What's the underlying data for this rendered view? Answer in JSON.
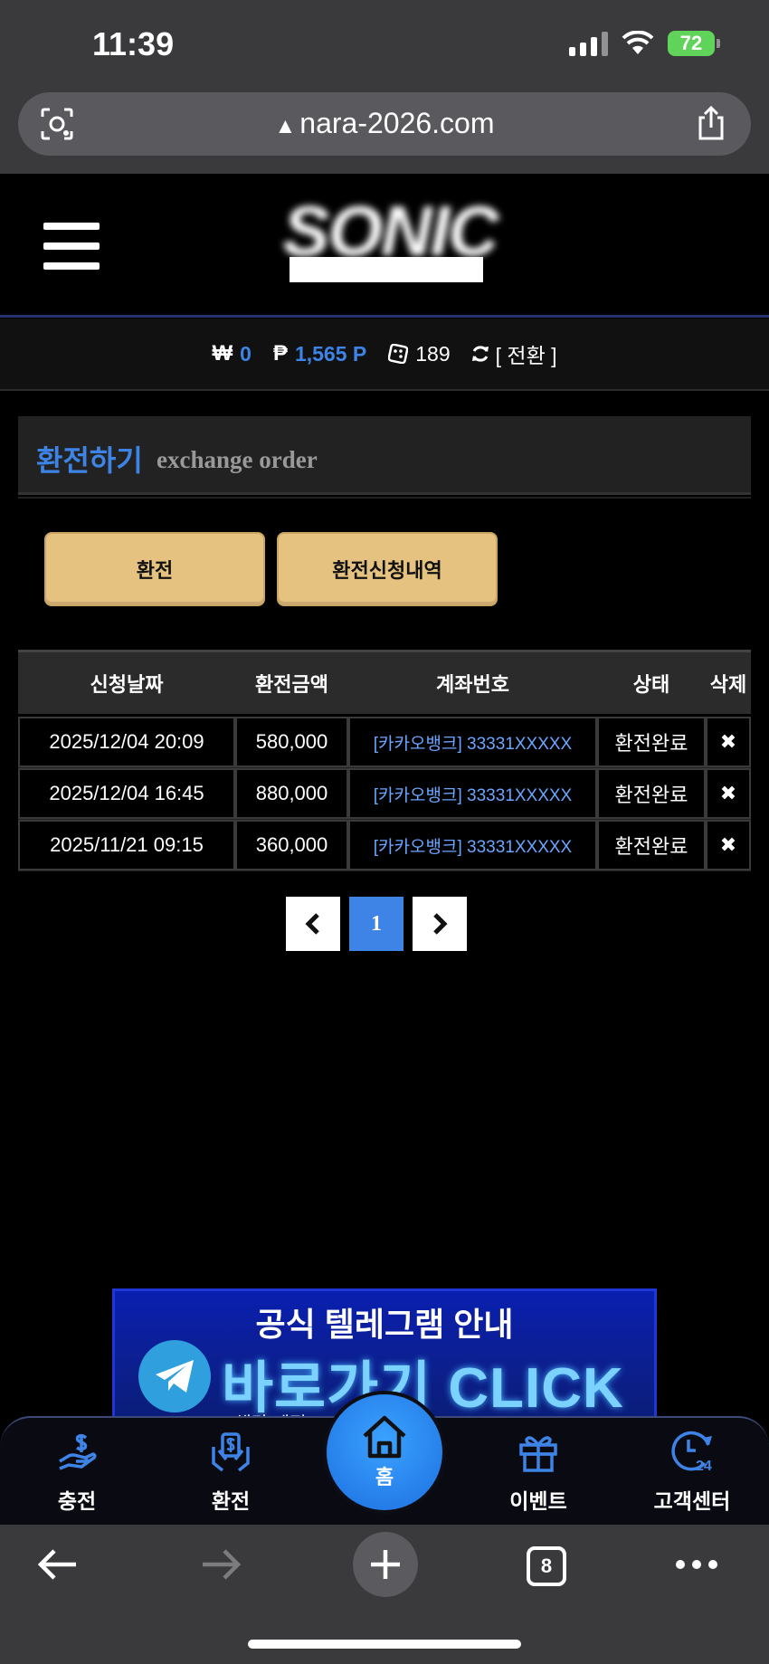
{
  "status_bar": {
    "time": "11:39",
    "battery": "72"
  },
  "browser": {
    "url": "nara-2026.com"
  },
  "header": {
    "logo_text": "SONIC"
  },
  "balance": {
    "cash_symbol": "₩",
    "cash": "0",
    "point_symbol": "₱",
    "points": "1,565 P",
    "chips": "189",
    "convert_label": "[ 전환 ]"
  },
  "page": {
    "title_ko": "환전하기",
    "title_en": "exchange order"
  },
  "actions": {
    "exchange_label": "환전",
    "history_label": "환전신청내역"
  },
  "table": {
    "headers": [
      "신청날짜",
      "환전금액",
      "계좌번호",
      "상태",
      "삭제"
    ],
    "rows": [
      {
        "date": "2025/12/04 20:09",
        "amount": "580,000",
        "account": "[카카오뱅크] 33331XXXXX",
        "status": "환전완료"
      },
      {
        "date": "2025/12/04 16:45",
        "amount": "880,000",
        "account": "[카카오뱅크] 33331XXXXX",
        "status": "환전완료"
      },
      {
        "date": "2025/11/21 09:15",
        "amount": "360,000",
        "account": "[카카오뱅크] 33331XXXXX",
        "status": "환전완료"
      }
    ]
  },
  "pagination": {
    "current": "1"
  },
  "banner": {
    "title": "공식 텔레그램 안내",
    "cta": "바로가기 CLICK",
    "note": "※ 해당 계정..."
  },
  "bottom_nav": {
    "items": [
      {
        "label": "충전",
        "icon": "hand-dollar-icon"
      },
      {
        "label": "환전",
        "icon": "hand-money-icon"
      },
      {
        "label": "홈",
        "icon": "home-icon"
      },
      {
        "label": "이벤트",
        "icon": "gift-icon"
      },
      {
        "label": "고객센터",
        "icon": "support-24-icon"
      }
    ]
  },
  "safari": {
    "tab_count": "8"
  },
  "colors": {
    "accent": "#3d84e6",
    "button": "#e6c280",
    "background": "#000000"
  }
}
